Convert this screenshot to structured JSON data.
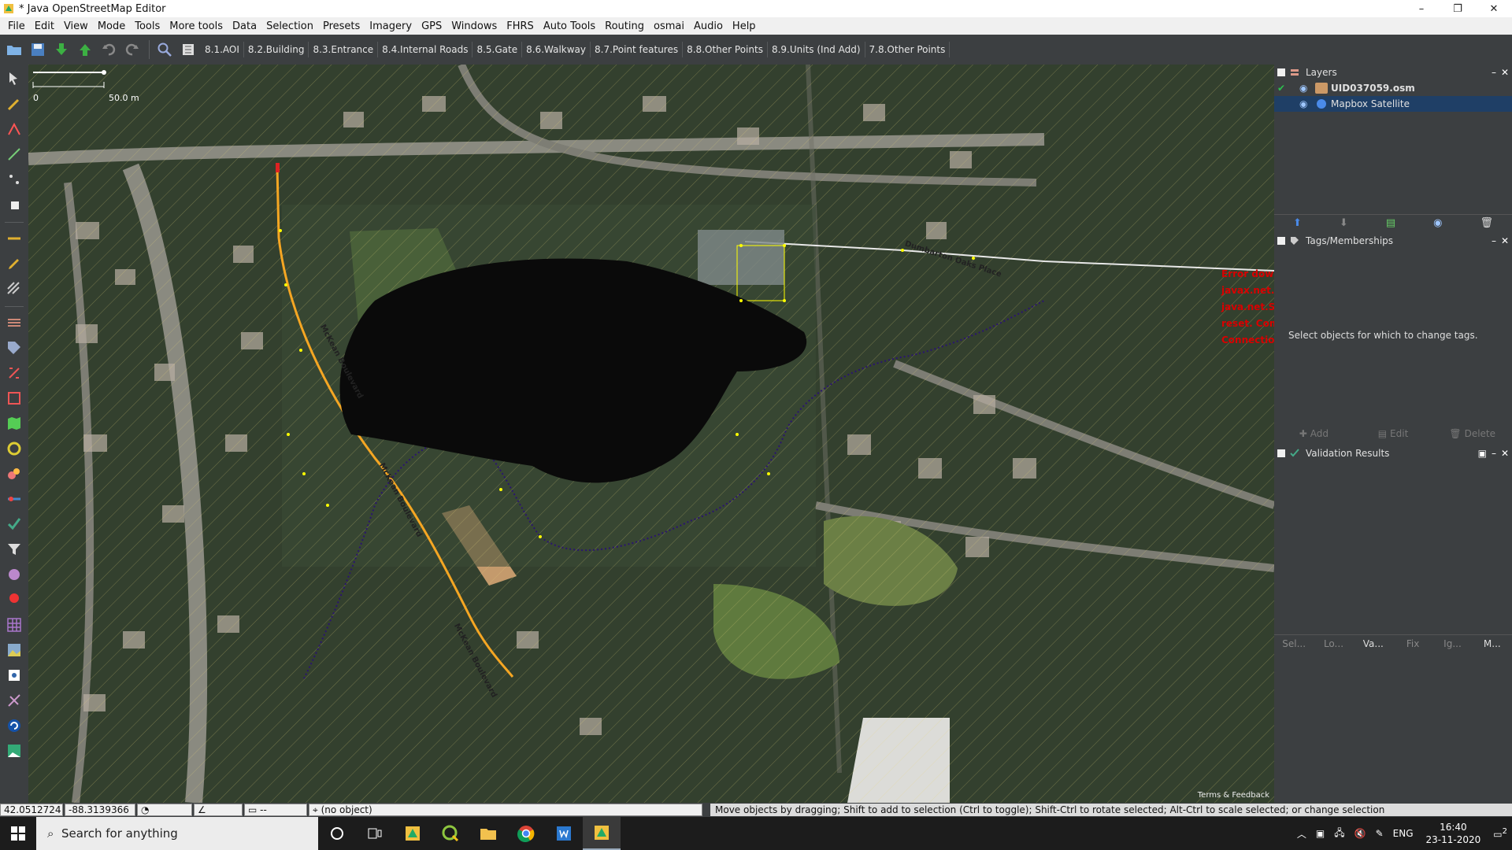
{
  "window": {
    "title": "* Java OpenStreetMap Editor"
  },
  "window_controls": {
    "minimize": "–",
    "restore": "❐",
    "close": "✕"
  },
  "menu": [
    "File",
    "Edit",
    "View",
    "Mode",
    "Tools",
    "More tools",
    "Data",
    "Selection",
    "Presets",
    "Imagery",
    "GPS",
    "Windows",
    "FHRS",
    "Auto Tools",
    "Routing",
    "osmai",
    "Audio",
    "Help"
  ],
  "toolbar": {
    "presets": [
      "8.1.AOI",
      "8.2.Building",
      "8.3.Entrance",
      "8.4.Internal Roads",
      "8.5.Gate",
      "8.6.Walkway",
      "8.7.Point features",
      "8.8.Other Points",
      "8.9.Units (Ind Add)",
      "7.8.Other Points"
    ]
  },
  "map": {
    "scale_label": "50.0 m",
    "scale_zero": "0",
    "attribution": "Terms & Feedback",
    "road_labels": [
      "McKean Boulevard",
      "Dumbarton Oaks Place",
      "McKean Boulevard",
      "McKean Boulevard"
    ],
    "error_lines": [
      "Error down",
      "javax.net.s",
      "java.net.So",
      "reset. Com",
      "Connection"
    ],
    "colors": {
      "road": "#f5a623",
      "path": "#2a1470",
      "selection": "#ffff00",
      "imagery_dark": "#0a0a0a"
    }
  },
  "layers": {
    "title": "Layers",
    "items": [
      {
        "name": "UID037059.osm",
        "checked": "✔"
      },
      {
        "name": "Mapbox Satellite",
        "checked": ""
      }
    ]
  },
  "tags": {
    "title": "Tags/Memberships",
    "empty_text": "Select objects for which to change tags.",
    "buttons": [
      "Add",
      "Edit",
      "Delete"
    ]
  },
  "validation": {
    "title": "Validation Results",
    "buttons": [
      "Sel...",
      "Lo...",
      "Va...",
      "Fix",
      "Ig...",
      "M..."
    ]
  },
  "status": {
    "lat": "42.0512724",
    "lon": "-88.3139366",
    "heading": "",
    "angle": "",
    "distance": "--",
    "object": "(no object)",
    "help": "Move objects by dragging; Shift to add to selection (Ctrl to toggle); Shift-Ctrl to rotate selected; Alt-Ctrl to scale selected; or change selection"
  },
  "taskbar": {
    "search_placeholder": "Search for anything",
    "language": "ENG",
    "time": "16:40",
    "date": "23-11-2020",
    "notifications": "2"
  }
}
